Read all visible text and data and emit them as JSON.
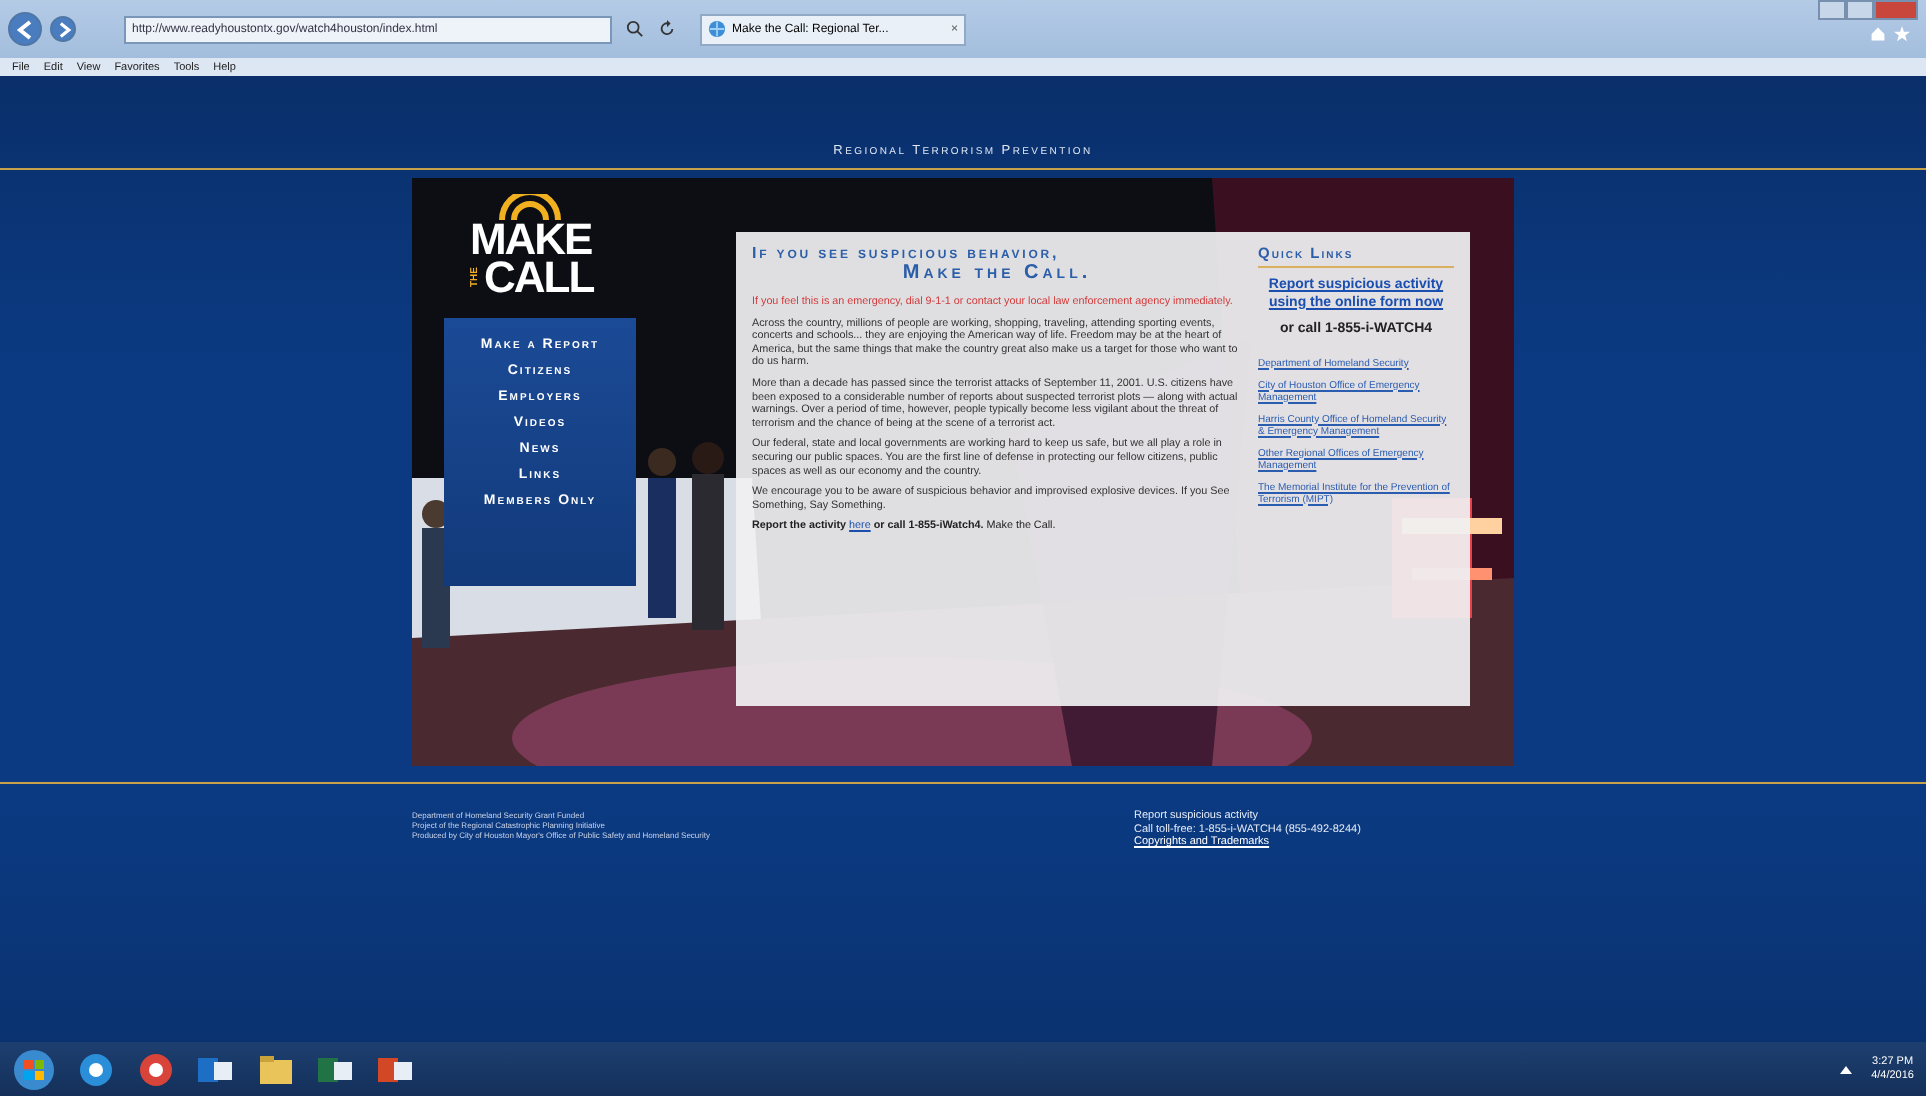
{
  "browser": {
    "address": "http://www.readyhoustontx.gov/watch4houston/index.html",
    "tab_title": "Make the Call: Regional Ter...",
    "tab_close": "×",
    "menu": [
      "File",
      "Edit",
      "View",
      "Favorites",
      "Tools",
      "Help"
    ]
  },
  "page": {
    "banner": "Regional Terrorism Prevention",
    "logo": {
      "top": "MAKE",
      "small": "THE",
      "bottom": "CALL"
    },
    "nav": [
      "Make a Report",
      "Citizens",
      "Employers",
      "Videos",
      "News",
      "Links",
      "Members Only"
    ],
    "content": {
      "heading_1": "If you see suspicious behavior,",
      "heading_2": "Make the Call.",
      "alert": "If you feel this is an emergency, dial 9-1-1 or contact your local law enforcement agency immediately.",
      "paragraphs": [
        "Across the country, millions of people are working, shopping, traveling, attending sporting events, concerts and schools... they are enjoying the American way of life. Freedom may be at the heart of America, but the same things that make the country great also make us a target for those who want to do us harm.",
        "More than a decade has passed since the terrorist attacks of September 11, 2001. U.S. citizens have been exposed to a considerable number of reports about suspected terrorist plots — along with actual warnings. Over a period of time, however, people typically become less vigilant about the threat of terrorism and the chance of being at the scene of a terrorist act.",
        "Our federal, state and local governments are working hard to keep us safe, but we all play a role in securing our public spaces. You are the first line of defense in protecting our fellow citizens, public spaces as well as our economy and the country.",
        "We encourage you to be aware of suspicious behavior and improvised explosive devices. If you See Something, Say Something."
      ],
      "report": {
        "before": "**Report the activity** ",
        "link": "here",
        "after": " **or call 1-855-iWatch4.** Make the Call."
      }
    },
    "quick_links": {
      "title": "Quick Links",
      "form_link": "Report suspicious activity using the online form now",
      "call": "or call 1-855-i-WATCH4",
      "links": [
        "Department of Homeland Security",
        "City of Houston Office of Emergency Management",
        "Harris County Office of Homeland Security & Emergency Management",
        "Other Regional Offices of Emergency Management",
        "The Memorial Institute for the Prevention of Terrorism (MIPT)"
      ]
    },
    "footer": {
      "credits": [
        "Department of Homeland Security Grant Funded",
        "Project of the Regional Catastrophic Planning Initiative",
        "Produced by City of Houston Mayor's Office of Public Safety and Homeland Security"
      ],
      "report_lines": [
        "Report suspicious activity",
        "Call toll-free: 1-855-i-WATCH4 (855-492-8244)"
      ],
      "copyright_link": "Copyrights and Trademarks"
    }
  },
  "taskbar": {
    "apps": [
      {
        "kind": "ie"
      },
      {
        "kind": "chrome"
      },
      {
        "kind": "outlook"
      },
      {
        "kind": "explorer"
      },
      {
        "kind": "excel"
      },
      {
        "kind": "powerpoint"
      }
    ],
    "time": "3:27 PM",
    "date": "4/4/2016"
  }
}
